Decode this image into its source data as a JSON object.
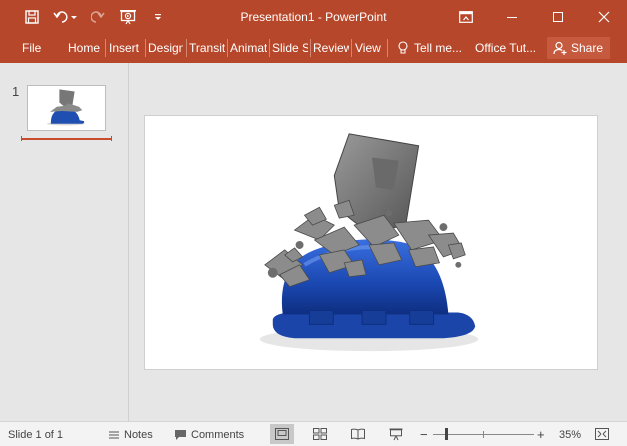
{
  "window": {
    "title": "Presentation1 - PowerPoint",
    "brand_color": "#b7472a"
  },
  "quick_access": [
    {
      "icon": "save-icon"
    },
    {
      "icon": "undo-icon"
    },
    {
      "icon": "redo-icon"
    },
    {
      "icon": "start-from-beginning-icon"
    },
    {
      "icon": "customize-qat-icon"
    }
  ],
  "window_controls": [
    {
      "icon": "ribbon-display-options-icon"
    },
    {
      "icon": "minimize-icon"
    },
    {
      "icon": "maximize-icon"
    },
    {
      "icon": "close-icon"
    }
  ],
  "ribbon": {
    "tabs": [
      "File",
      "Home",
      "Insert",
      "Design",
      "Transitions",
      "Animations",
      "Slide Show",
      "Review",
      "View"
    ],
    "tell_me": "Tell me...",
    "office_tut": "Office Tut...",
    "share": "Share"
  },
  "thumbnails": [
    {
      "number": "1",
      "selected": true
    }
  ],
  "slide": {
    "image": "blue hard hat hit by falling concrete block"
  },
  "status": {
    "slide_info": "Slide 1 of 1",
    "notes": "Notes",
    "comments": "Comments",
    "zoom": "35%",
    "zoom_level_fraction": 0.35
  }
}
